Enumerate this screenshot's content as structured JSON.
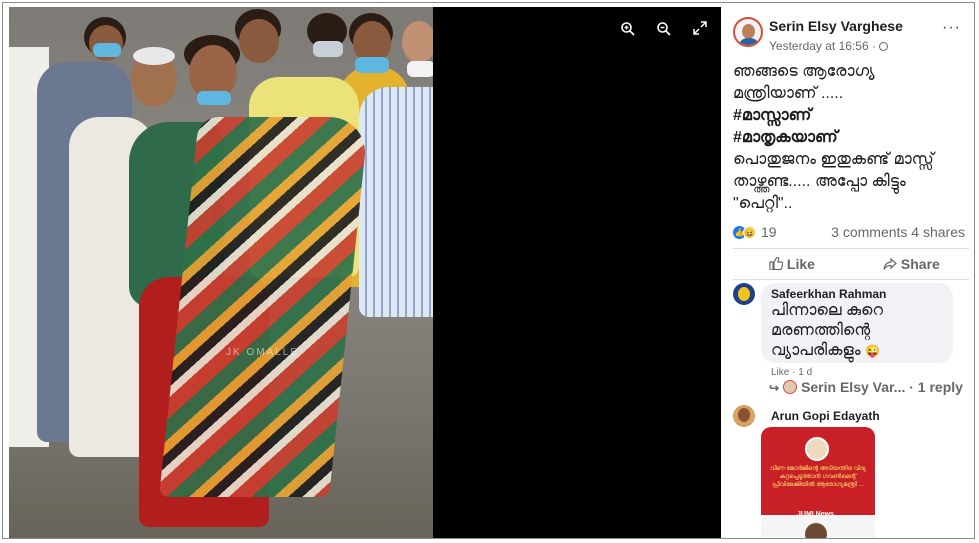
{
  "photo": {
    "watermark": "JK OMALLE"
  },
  "viewer": {
    "zoom_in_icon": "zoom-in-icon",
    "zoom_out_icon": "zoom-out-icon",
    "fullscreen_icon": "expand-icon"
  },
  "post": {
    "author": "Serin Elsy Varghese",
    "timestamp": "Yesterday at 16:56 ·",
    "more": "···",
    "text_lines": [
      "ഞങ്ങടെ ആരോഗ്യ",
      "മന്ത്രിയാണ് ....."
    ],
    "hashtags": [
      "#മാസ്സാണ്",
      "#മാതൃകയാണ്"
    ],
    "text_lines_2": [
      "പൊതുജനം ഇതുകണ്ട് മാസ്സ്",
      "താഴ്ത്തണ്ട..... അപ്പോ കിട്ടും",
      "\"പെറ്റി\".."
    ],
    "reaction_count": "19",
    "comments_shares": "3 comments 4 shares",
    "like_label": "Like",
    "share_label": "Share"
  },
  "comments": [
    {
      "name": "Safeerkhan Rahman",
      "text_lines": [
        "പിന്നാലെ കുറെ",
        "മരണത്തിന്റെ",
        "വ്യാപരികളും"
      ],
      "emoji": "😜",
      "meta": "Like · 1 d"
    },
    {
      "name": "Arun Gopi Edayath",
      "attachment_text": "വീണ ജോർജിന്റെ അടിയന്തിര വിദ്യ കുറ്റപ്പെടുത്താൻ ഗവൺമെന്റ് പ്രിവിലേജിയിൽ ആരോഗ്യമന്ത്രി ...",
      "attachment_logo": "JUMI News"
    }
  ],
  "reply": {
    "author": "Serin Elsy Var...",
    "label": "· 1 reply"
  },
  "colors": {
    "accent": "#1877f2",
    "viewer_bg": "#000000",
    "bubble_bg": "#f0f2f5"
  }
}
